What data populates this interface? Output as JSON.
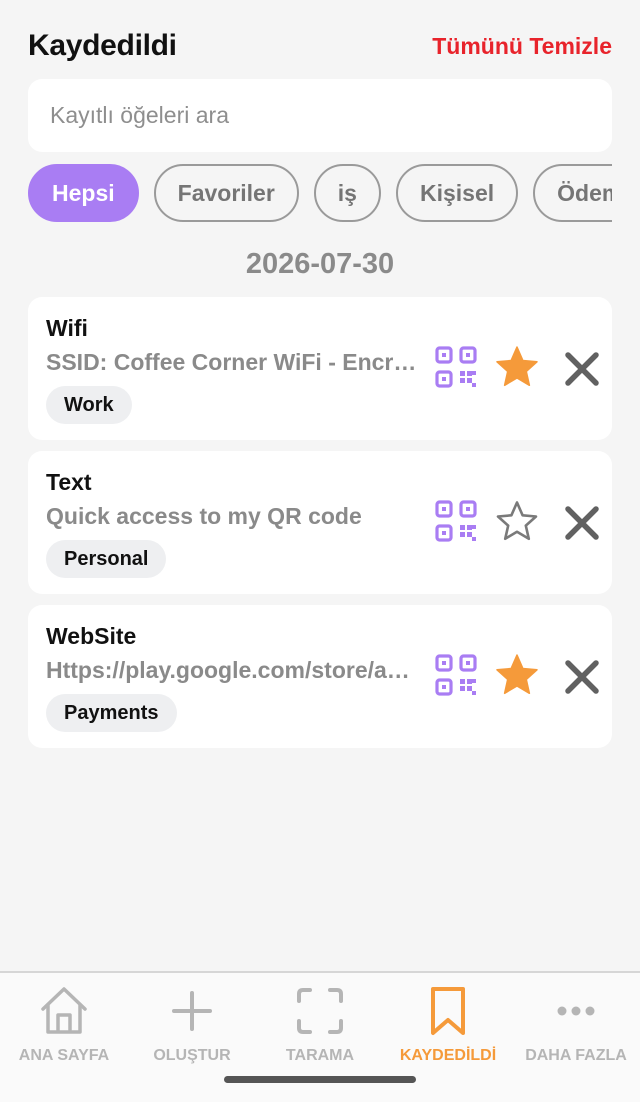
{
  "header": {
    "title": "Kaydedildi",
    "clear_all": "Tümünü Temizle"
  },
  "search": {
    "placeholder": "Kayıtlı öğeleri ara",
    "value": ""
  },
  "filters": [
    {
      "label": "Hepsi",
      "active": true
    },
    {
      "label": "Favoriler",
      "active": false
    },
    {
      "label": "iş",
      "active": false
    },
    {
      "label": "Kişisel",
      "active": false
    },
    {
      "label": "Ödeme",
      "active": false
    }
  ],
  "date_group": "2026-07-30",
  "items": [
    {
      "type": "Wifi",
      "content": "SSID: Coffee Corner WiFi - Encryption: WPA",
      "tag": "Work",
      "favorite": true
    },
    {
      "type": "Text",
      "content": "Quick access to my QR code",
      "tag": "Personal",
      "favorite": false
    },
    {
      "type": "WebSite",
      "content": "Https://play.google.com/store/apps",
      "tag": "Payments",
      "favorite": true
    }
  ],
  "nav": [
    {
      "label": "ANA SAYFA",
      "icon": "home-icon",
      "active": false
    },
    {
      "label": "OLUŞTUR",
      "icon": "plus-icon",
      "active": false
    },
    {
      "label": "TARAMA",
      "icon": "scan-frame-icon",
      "active": false
    },
    {
      "label": "KAYDEDİLDİ",
      "icon": "bookmark-icon",
      "active": true
    },
    {
      "label": "DAHA FAZLA",
      "icon": "more-dots-icon",
      "active": false
    }
  ],
  "colors": {
    "accent_purple": "#a97df3",
    "star_orange": "#f59a3a",
    "danger_red": "#e8232b",
    "active_nav": "#f59a3a",
    "inactive_nav": "#b5b5b5"
  }
}
